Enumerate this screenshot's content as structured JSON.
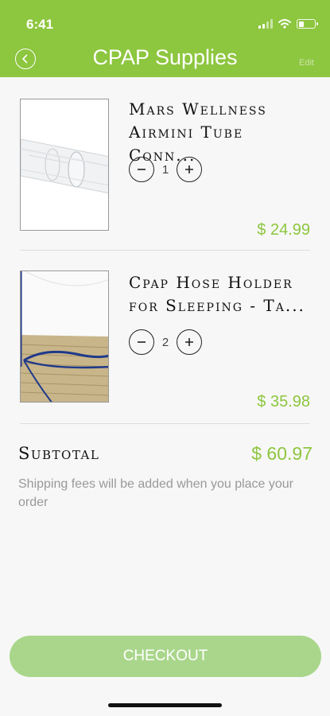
{
  "status_bar": {
    "time": "6:41"
  },
  "header": {
    "title": "CPAP Supplies",
    "edit_label": "Edit",
    "back_icon": "chevron-left-icon"
  },
  "cart": {
    "items": [
      {
        "name": "Mars Wellness\nAirmini Tube Conn...",
        "quantity": "1",
        "price": "$ 24.99"
      },
      {
        "name": "Cpap Hose Holder\nfor Sleeping - Ta...",
        "quantity": "2",
        "price": "$ 35.98"
      }
    ],
    "subtotal_label": "Subtotal",
    "subtotal_value": "$ 60.97",
    "shipping_note": "Shipping fees will be added when you place your order"
  },
  "checkout": {
    "label": "CHECKOUT"
  },
  "colors": {
    "accent": "#8dc63f",
    "checkout_bg": "#a9d68b"
  }
}
